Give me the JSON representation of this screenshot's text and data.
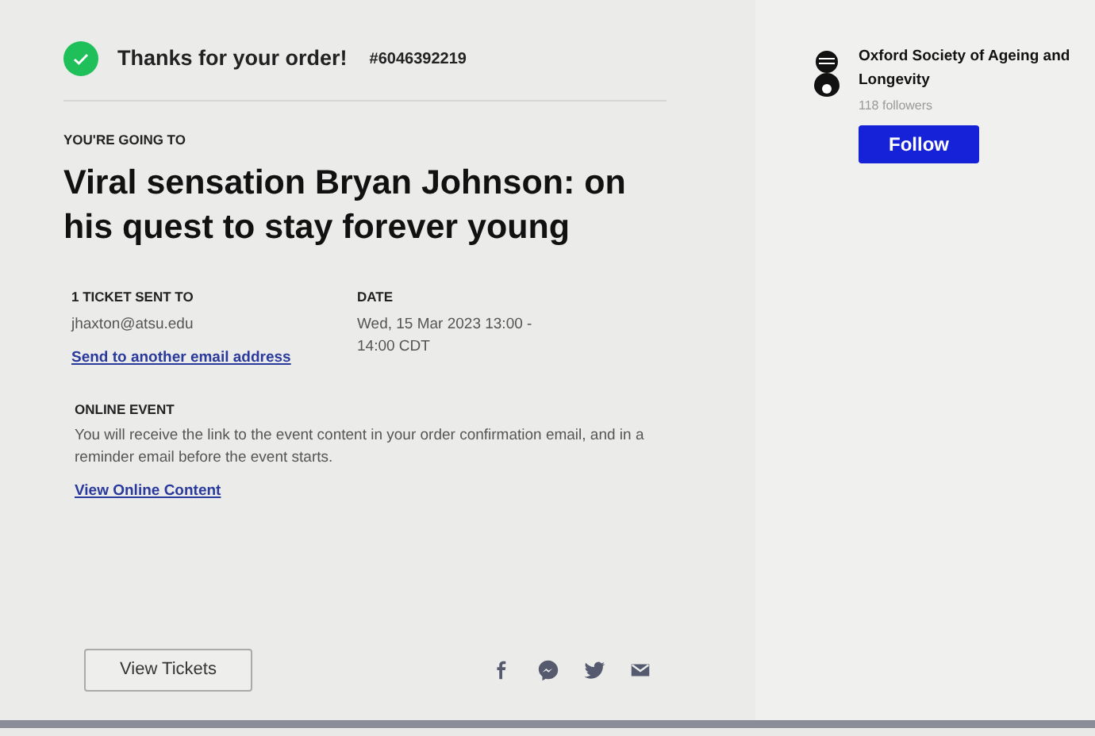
{
  "confirmation": {
    "title": "Thanks for your order!",
    "order_number": "#6046392219"
  },
  "event": {
    "eyebrow": "YOU'RE GOING TO",
    "title": "Viral sensation Bryan Johnson: on his quest to stay forever young"
  },
  "details": [
    {
      "label": "1 TICKET SENT TO",
      "lines": [
        "jhaxton@atsu.edu"
      ],
      "link": "Send to another email address"
    },
    {
      "label": "DATE",
      "lines": [
        "Wed, 15 Mar 2023 13:00 -",
        "14:00 CDT"
      ]
    }
  ],
  "online_event": {
    "label": "ONLINE EVENT",
    "text": "You will receive the link to the event content in your order confirmation email, and in a reminder email before the event starts.",
    "link": "View Online Content"
  },
  "actions": {
    "button": "View Tickets",
    "share": [
      {
        "kind": "facebook"
      },
      {
        "kind": "messenger"
      },
      {
        "kind": "twitter"
      },
      {
        "kind": "email"
      }
    ]
  },
  "organizer": {
    "name": "Oxford Society of Ageing and Longevity",
    "followers": "118 followers",
    "button": "Follow"
  }
}
